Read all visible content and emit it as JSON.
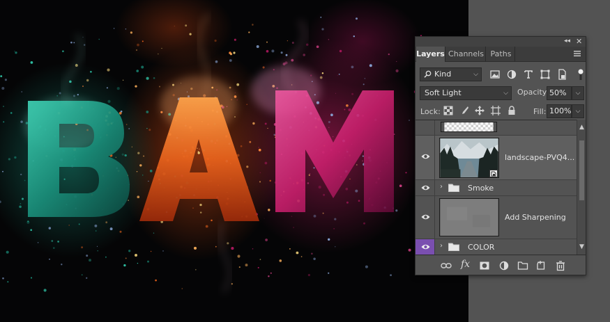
{
  "panel": {
    "tabs": [
      "Layers",
      "Channels",
      "Paths"
    ],
    "kind_filter": "Kind",
    "blend_mode": "Soft Light",
    "opacity_label": "Opacity:",
    "opacity_value": "50%",
    "lock_label": "Lock:",
    "fill_label": "Fill:",
    "fill_value": "100%"
  },
  "layers": [
    {
      "name": "",
      "type": "mask"
    },
    {
      "name": "landscape-PVQ4...",
      "type": "smart-object",
      "visible": true,
      "selected": true
    },
    {
      "name": "Smoke",
      "type": "group",
      "visible": true
    },
    {
      "name": "Add Sharpening",
      "type": "layer",
      "visible": true
    },
    {
      "name": "COLOR",
      "type": "group",
      "visible": true,
      "eye_color": "#7a4fb0"
    }
  ],
  "canvas": {
    "letters": [
      "B",
      "A",
      "M"
    ],
    "colors": {
      "B": "#1f9c86",
      "A": "#e8621c",
      "M": "#c81f6c"
    }
  },
  "colors": {
    "panel_bg": "#535353",
    "header_bg": "#3c3c3c",
    "selected_row": "#5e5e5e",
    "purple_eye": "#7a4fb0"
  }
}
